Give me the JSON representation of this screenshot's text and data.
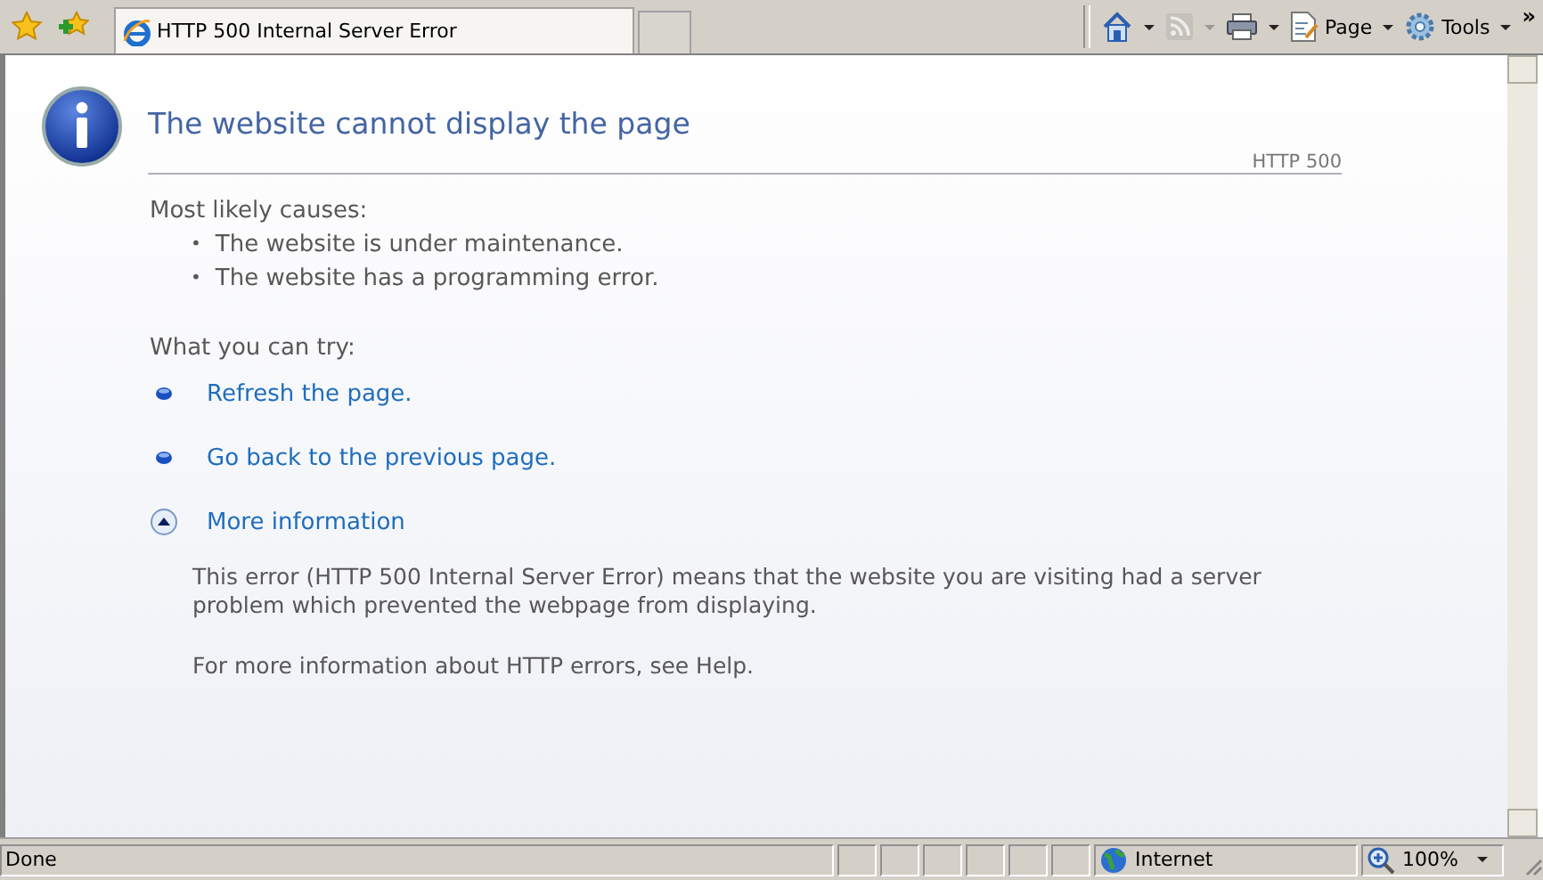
{
  "toolbar": {
    "tab": {
      "title": "HTTP 500 Internal Server Error",
      "selected": true
    },
    "commands": [
      {
        "kind": "home",
        "disabled": false
      },
      {
        "kind": "feed",
        "disabled": true
      },
      {
        "kind": "print",
        "disabled": false
      },
      {
        "kind": "page",
        "label": "Page",
        "disabled": false
      },
      {
        "kind": "tools",
        "label": "Tools",
        "disabled": false
      }
    ],
    "overflow": "»"
  },
  "page": {
    "title": "The website cannot display the page",
    "code": "HTTP 500",
    "causes_heading": "Most likely causes:",
    "causes": [
      {
        "marker": "•",
        "text": "The website is under maintenance."
      },
      {
        "marker": "•",
        "text": "The website has a programming error."
      }
    ],
    "try_heading": "What you can try:",
    "actions": [
      {
        "kind": "bullet",
        "label": "Refresh the page."
      },
      {
        "kind": "bullet",
        "label": "Go back to the previous page."
      },
      {
        "kind": "toggle",
        "label": "More information",
        "expanded": true
      }
    ],
    "details": [
      "This error (HTTP 500 Internal Server Error) means that the website you are visiting had a server problem which prevented the webpage from displaying.",
      "For more information about HTTP errors, see Help."
    ]
  },
  "status_bar": {
    "text": "Done",
    "zone": "Internet",
    "zoom": "100%"
  }
}
